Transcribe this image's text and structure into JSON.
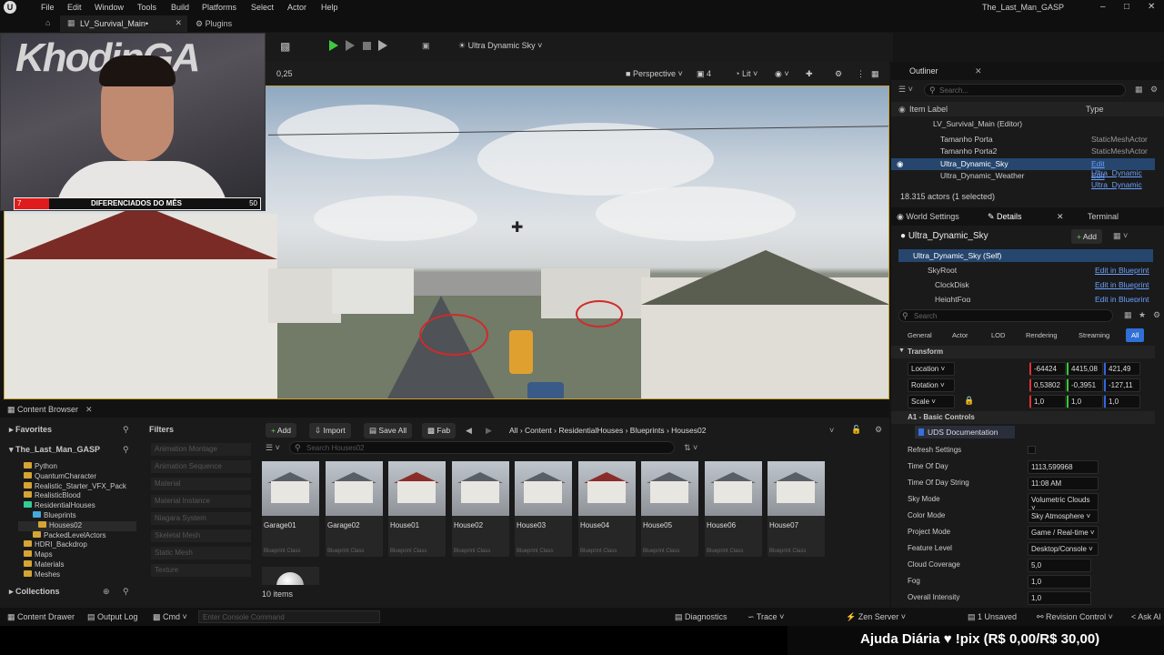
{
  "menubar": {
    "items": [
      "File",
      "Edit",
      "Window",
      "Tools",
      "Build",
      "Platforms",
      "Select",
      "Actor",
      "Help"
    ],
    "window_title": "The_Last_Man_GASP"
  },
  "tabs": {
    "level": "LV_Survival_Main•",
    "plugins": "Plugins"
  },
  "toolbar": {
    "sky_dropdown": "Ultra Dynamic Sky",
    "zoom": "0,25"
  },
  "viewport_options": {
    "perspective": "Perspective",
    "fov": "4",
    "lit": "Lit"
  },
  "webcam": {
    "logo_text": "KhodinGA",
    "banner_left": "7",
    "banner_text": "DIFERENCIADOS DO MÊS",
    "banner_right": "50"
  },
  "outliner": {
    "title": "Outliner",
    "search_placeholder": "Search...",
    "col_label": "Item Label",
    "col_type": "Type",
    "rows": [
      {
        "label": "LV_Survival_Main (Editor)",
        "type": ""
      },
      {
        "label": "Tamanho Porta",
        "type": "StaticMeshActor"
      },
      {
        "label": "Tamanho Porta2",
        "type": "StaticMeshActor"
      },
      {
        "label": "Ultra_Dynamic_Sky",
        "type": "Edit Ultra_Dynamic"
      },
      {
        "label": "Ultra_Dynamic_Weather",
        "type": "Edit Ultra_Dynamic"
      }
    ],
    "count": "18.315 actors (1 selected)"
  },
  "details": {
    "tab_world": "World Settings",
    "tab_details": "Details",
    "tab_terminal": "Terminal",
    "actor_name": "Ultra_Dynamic_Sky",
    "add_label": "Add",
    "components": [
      {
        "label": "Ultra_Dynamic_Sky (Self)",
        "link": ""
      },
      {
        "label": "SkyRoot",
        "link": "Edit in Blueprint"
      },
      {
        "label": "ClockDisk",
        "link": "Edit in Blueprint"
      },
      {
        "label": "HeightFog",
        "link": "Edit in Blueprint"
      }
    ],
    "search_placeholder": "Search",
    "filter_tabs": [
      "General",
      "Actor",
      "LOD",
      "Rendering",
      "Streaming",
      "All"
    ],
    "transform_header": "Transform",
    "location_label": "Location",
    "location": [
      "-64424",
      "4415,08",
      "421,49"
    ],
    "rotation_label": "Rotation",
    "rotation": [
      "0,53802",
      "-0,3951",
      "-127,11"
    ],
    "scale_label": "Scale",
    "scale": [
      "1,0",
      "1,0",
      "1,0"
    ],
    "basic_header": "A1 - Basic Controls",
    "uds_doc": "UDS Documentation",
    "props": [
      {
        "label": "Refresh Settings",
        "value": ""
      },
      {
        "label": "Time Of Day",
        "value": "1113,599968"
      },
      {
        "label": "Time Of Day String",
        "value": "11:08 AM"
      },
      {
        "label": "Sky Mode",
        "value": "Volumetric Clouds"
      },
      {
        "label": "Color Mode",
        "value": "Sky Atmosphere"
      },
      {
        "label": "Project Mode",
        "value": "Game / Real-time"
      },
      {
        "label": "Feature Level",
        "value": "Desktop/Console"
      },
      {
        "label": "Cloud Coverage",
        "value": "5,0"
      },
      {
        "label": "Fog",
        "value": "1,0"
      },
      {
        "label": "Overall Intensity",
        "value": "1,0"
      }
    ]
  },
  "content_browser": {
    "title": "Content Browser",
    "favorites": "Favorites",
    "project": "The_Last_Man_GASP",
    "tree": [
      "Python",
      "QuantumCharacter",
      "Realistic_Starter_VFX_Pack",
      "RealisticBlood",
      "ResidentialHouses",
      "Blueprints",
      "Houses02",
      "PackedLevelActors",
      "HDRI_Backdrop",
      "Maps",
      "Materials",
      "Meshes"
    ],
    "collections": "Collections",
    "filters_title": "Filters",
    "filters": [
      "Animation Montage",
      "Animation Sequence",
      "Material",
      "Material Instance",
      "Niagara System",
      "Skeletal Mesh",
      "Static Mesh",
      "Texture"
    ],
    "add": "Add",
    "import": "Import",
    "save_all": "Save All",
    "fab": "Fab",
    "path": [
      "All",
      "Content",
      "ResidentialHouses",
      "Blueprints",
      "Houses02"
    ],
    "search_placeholder": "Search Houses02",
    "assets": [
      "Garage01",
      "Garage02",
      "House01",
      "House02",
      "House03",
      "House04",
      "House05",
      "House06",
      "House07"
    ],
    "asset_class": "Blueprint Class",
    "item_count": "10 items"
  },
  "statusbar": {
    "content_drawer": "Content Drawer",
    "output_log": "Output Log",
    "cmd": "Cmd",
    "console_placeholder": "Enter Console Command",
    "diagnostics": "Diagnostics",
    "trace": "Trace",
    "zen": "Zen Server",
    "unsaved": "1 Unsaved",
    "revision": "Revision Control",
    "ask": "Ask AI"
  },
  "donation": "Ajuda Diária ♥ !pix (R$ 0,00/R$ 30,00)"
}
